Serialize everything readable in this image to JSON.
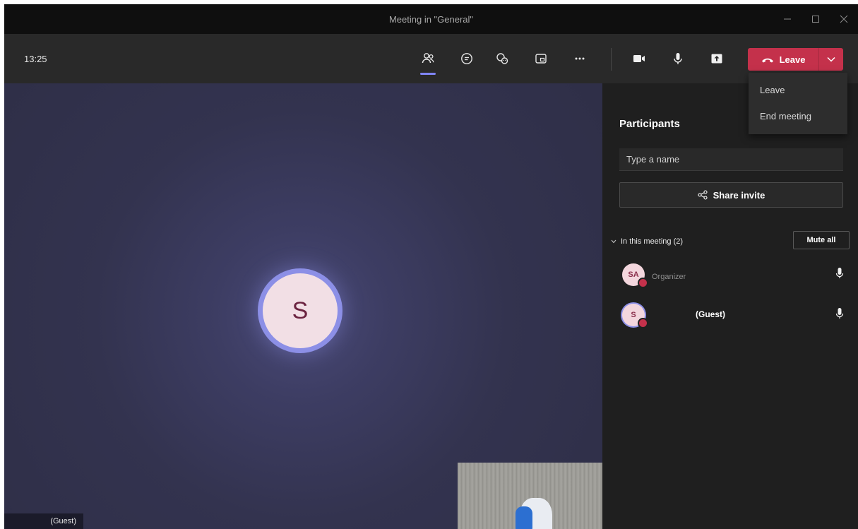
{
  "window": {
    "title": "Meeting in \"General\"",
    "controls": [
      "minimize-icon",
      "maximize-icon",
      "close-icon"
    ]
  },
  "toolbar": {
    "time": "13:25",
    "icons": [
      "participants-icon",
      "chat-icon",
      "reactions-icon",
      "rooms-icon",
      "more-options-icon",
      "camera-icon",
      "microphone-icon",
      "share-screen-icon"
    ],
    "leave_label": "Leave",
    "leave_color": "#c4314b"
  },
  "leave_menu": {
    "items": [
      "Leave",
      "End meeting"
    ]
  },
  "stage": {
    "main_avatar_initial": "S",
    "name_tag": "(Guest)"
  },
  "participants": {
    "title": "Participants",
    "search_placeholder": "Type a name",
    "share_invite_label": "Share invite",
    "section_label": "In this meeting (2)",
    "mute_all_label": "Mute all",
    "people": [
      {
        "initials": "SA",
        "role": "Organizer",
        "name": ""
      },
      {
        "initials": "S",
        "role": "",
        "name": "(Guest)"
      }
    ]
  },
  "colors": {
    "accent": "#7f85f5",
    "leave": "#c4314b",
    "panel_bg": "#1f1f1f"
  }
}
